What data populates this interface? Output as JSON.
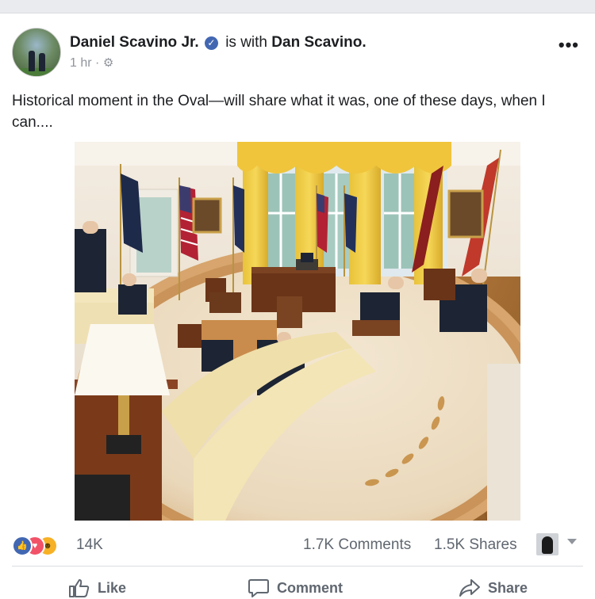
{
  "post": {
    "author": "Daniel Scavino Jr.",
    "with_text": "is with",
    "tagged": "Dan Scavino.",
    "time": "1 hr",
    "separator": "·",
    "verified_glyph": "✓",
    "more_glyph": "•••",
    "text": "Historical moment in the Oval—will share what it was, one of these days, when I can...."
  },
  "stats": {
    "reactions_count": "14K",
    "comments": "1.7K Comments",
    "shares": "1.5K Shares",
    "reaction_types": [
      "like",
      "love",
      "wow"
    ]
  },
  "actions": {
    "like": "Like",
    "comment": "Comment",
    "share": "Share"
  },
  "icons": {
    "like": "thumbs-up-icon",
    "comment": "comment-bubble-icon",
    "share": "share-arrow-icon",
    "privacy": "gear-icon"
  },
  "colors": {
    "link_blue": "#4267b2",
    "love_red": "#f25268",
    "wow_yellow": "#f7b125",
    "muted_text": "#606770",
    "meta_text": "#90949c"
  }
}
